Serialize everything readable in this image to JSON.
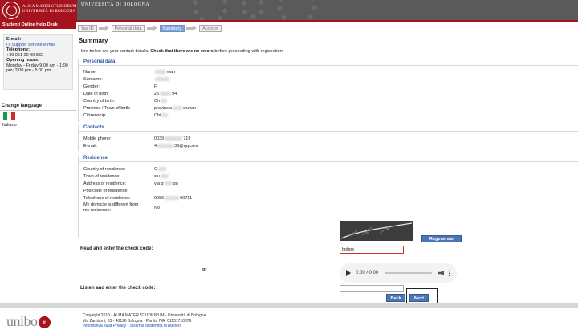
{
  "header": {
    "logo_line1": "ALMA MATER STUDIORUM",
    "logo_line2": "UNIVERSITÀ DI BOLOGNA",
    "university_name": "UNIVERSITÀ DI BOLOGNA",
    "accent_color": "#a5141d"
  },
  "sidebar": {
    "title": "Studenti Online Help Desk",
    "email_label": "E-mail:",
    "email_link": "IT Support service e-mail",
    "telephone_label": "Telephone:",
    "telephone": "+39 051 20 99 882",
    "hours_label": "Opening hours:",
    "hours": "Monday - Friday 9:00 am - 1:00 pm; 2:00 pm - 5:00 pm",
    "change_language": "Change language",
    "language": "Italiano"
  },
  "steps": [
    "Tax ID",
    "Personal data",
    "Summary",
    "Account"
  ],
  "active_step": "Summary",
  "summary": {
    "title": "Summary",
    "intro_pre": "Here below are your contact details.",
    "intro_bold": "Check that there are no errors",
    "intro_post": "before proceeding with registration"
  },
  "personal": {
    "heading": "Personal data",
    "name_label": "Name:",
    "name": "wan",
    "surname_label": "Surname:",
    "gender_label": "Gender:",
    "gender": "F",
    "dob_label": "Date of birth:",
    "dob_pre": "26",
    "dob_post": "94",
    "country_label": "Country of birth:",
    "country": "Ch",
    "province_label": "Province / Town of birth:",
    "province_pre": "provincia",
    "province_post": "wuhan",
    "citizenship_label": "Citizenship:",
    "citizenship": "Chi"
  },
  "contacts": {
    "heading": "Contacts",
    "mobile_label": "Mobile phone:",
    "mobile_pre": "0039",
    "mobile_post": "719",
    "email_label": "E-mail:",
    "email_pre": "4",
    "email_post": "36@qq.com"
  },
  "residence": {
    "heading": "Residence",
    "country_label": "Country of residence:",
    "country": "C",
    "town_label": "Town of residence:",
    "town": "wu",
    "address_label": "Address of residence:",
    "address_pre": "via g",
    "address_post": "gu",
    "postcode_label": "Postcode of residence:",
    "tel_label": "Telephone of residence:",
    "tel_pre": "0086",
    "tel_post": "90711",
    "domicile_label_1": "My domicile is different from",
    "domicile_label_2": "my residence:",
    "domicile": "No"
  },
  "captcha": {
    "regenerate": "Regenerate",
    "check_label": "Read and enter the check code:",
    "check_value": "bphpx",
    "or": "or",
    "audio_time": "0:00 / 0:00",
    "listen_label": "Listen and enter the check code:"
  },
  "buttons": {
    "back": "Back",
    "next": "Next"
  },
  "footer": {
    "logo": "unibo",
    "logo_suffix": "it",
    "line1": "Copyright 2019 - ALMA MATER STUDIORUM - Università di Bologna",
    "line2": "Via Zamboni, 33 - 40126 Bologna - Partita IVA: 01131710376",
    "privacy": "Informativa sulla Privacy",
    "sep": " - ",
    "identity": "Sistema di identità di Ateneo"
  }
}
